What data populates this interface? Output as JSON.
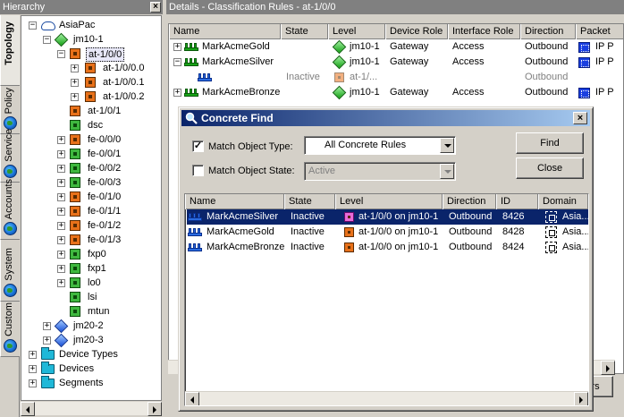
{
  "hierarchy": {
    "title": "Hierarchy",
    "tabs": [
      {
        "label": "Topology",
        "active": true
      },
      {
        "label": "Policy"
      },
      {
        "label": "Service"
      },
      {
        "label": "Accounts"
      },
      {
        "label": "System"
      },
      {
        "label": "Custom"
      }
    ],
    "tree": [
      {
        "label": "AsiaPac",
        "depth": 0,
        "expander": "-",
        "icon": "cloud"
      },
      {
        "label": "jm10-1",
        "depth": 1,
        "expander": "-",
        "icon": "diamond-green"
      },
      {
        "label": "at-1/0/0",
        "depth": 2,
        "expander": "-",
        "icon": "port-orange",
        "selected": true
      },
      {
        "label": "at-1/0/0.0",
        "depth": 3,
        "expander": "+",
        "icon": "port-orange"
      },
      {
        "label": "at-1/0/0.1",
        "depth": 3,
        "expander": "+",
        "icon": "port-orange"
      },
      {
        "label": "at-1/0/0.2",
        "depth": 3,
        "expander": "+",
        "icon": "port-orange"
      },
      {
        "label": "at-1/0/1",
        "depth": 2,
        "expander": "",
        "icon": "port-orange"
      },
      {
        "label": "dsc",
        "depth": 2,
        "expander": "",
        "icon": "port-green"
      },
      {
        "label": "fe-0/0/0",
        "depth": 2,
        "expander": "+",
        "icon": "port-orange"
      },
      {
        "label": "fe-0/0/1",
        "depth": 2,
        "expander": "+",
        "icon": "port-green"
      },
      {
        "label": "fe-0/0/2",
        "depth": 2,
        "expander": "+",
        "icon": "port-green"
      },
      {
        "label": "fe-0/0/3",
        "depth": 2,
        "expander": "+",
        "icon": "port-green"
      },
      {
        "label": "fe-0/1/0",
        "depth": 2,
        "expander": "+",
        "icon": "port-orange"
      },
      {
        "label": "fe-0/1/1",
        "depth": 2,
        "expander": "+",
        "icon": "port-orange"
      },
      {
        "label": "fe-0/1/2",
        "depth": 2,
        "expander": "+",
        "icon": "port-orange"
      },
      {
        "label": "fe-0/1/3",
        "depth": 2,
        "expander": "+",
        "icon": "port-orange"
      },
      {
        "label": "fxp0",
        "depth": 2,
        "expander": "+",
        "icon": "port-green"
      },
      {
        "label": "fxp1",
        "depth": 2,
        "expander": "+",
        "icon": "port-green"
      },
      {
        "label": "lo0",
        "depth": 2,
        "expander": "+",
        "icon": "port-green"
      },
      {
        "label": "lsi",
        "depth": 2,
        "expander": "",
        "icon": "port-green"
      },
      {
        "label": "mtun",
        "depth": 2,
        "expander": "",
        "icon": "port-green"
      },
      {
        "label": "jm20-2",
        "depth": 1,
        "expander": "+",
        "icon": "diamond-blue"
      },
      {
        "label": "jm20-3",
        "depth": 1,
        "expander": "+",
        "icon": "diamond-blue"
      },
      {
        "label": "Device Types",
        "depth": 0,
        "expander": "+",
        "icon": "folder"
      },
      {
        "label": "Devices",
        "depth": 0,
        "expander": "+",
        "icon": "folder"
      },
      {
        "label": "Segments",
        "depth": 0,
        "expander": "+",
        "icon": "folder"
      }
    ]
  },
  "details": {
    "title": "Details - Classification Rules - at-1/0/0",
    "columns": [
      "Name",
      "State",
      "Level",
      "Device Role",
      "Interface Role",
      "Direction",
      "Packet"
    ],
    "rows": [
      {
        "expander": "+",
        "icon": "rule-green",
        "name": "MarkAcmeGold",
        "state": "",
        "level": "jm10-1",
        "device_role": "Gateway",
        "interface_role": "Access",
        "direction": "Outbound",
        "packet": "IP P"
      },
      {
        "expander": "-",
        "icon": "rule-green",
        "name": "MarkAcmeSilver",
        "state": "",
        "level": "jm10-1",
        "device_role": "Gateway",
        "interface_role": "Access",
        "direction": "Outbound",
        "packet": "IP P"
      },
      {
        "expander": "",
        "icon": "rule-blue",
        "name": "",
        "state": "Inactive",
        "level": "at-1/...",
        "device_role": "",
        "interface_role": "",
        "direction": "Outbound",
        "packet": "",
        "muted": true
      },
      {
        "expander": "+",
        "icon": "rule-green",
        "name": "MarkAcmeBronze",
        "state": "",
        "level": "jm10-1",
        "device_role": "Gateway",
        "interface_role": "Access",
        "direction": "Outbound",
        "packet": "IP P"
      }
    ],
    "partial_button": "rs"
  },
  "dialog": {
    "title": "Concrete Find",
    "match_type_label": "Match Object Type:",
    "match_type_checked": true,
    "match_type_value": "All Concrete Rules",
    "match_state_label": "Match Object State:",
    "match_state_checked": false,
    "match_state_value": "Active",
    "find_button": "Find",
    "close_button": "Close",
    "columns": [
      "Name",
      "State",
      "Level",
      "Direction",
      "ID",
      "Domain"
    ],
    "results": [
      {
        "name": "MarkAcmeSilver",
        "state": "Inactive",
        "level": "at-1/0/0 on jm10-1",
        "direction": "Outbound",
        "id": "8426",
        "domain": "Asia...",
        "selected": true,
        "level_icon": "pink"
      },
      {
        "name": "MarkAcmeGold",
        "state": "Inactive",
        "level": "at-1/0/0 on jm10-1",
        "direction": "Outbound",
        "id": "8428",
        "domain": "Asia...",
        "level_icon": "orange"
      },
      {
        "name": "MarkAcmeBronze",
        "state": "Inactive",
        "level": "at-1/0/0 on jm10-1",
        "direction": "Outbound",
        "id": "8424",
        "domain": "Asia...",
        "level_icon": "orange"
      }
    ]
  }
}
